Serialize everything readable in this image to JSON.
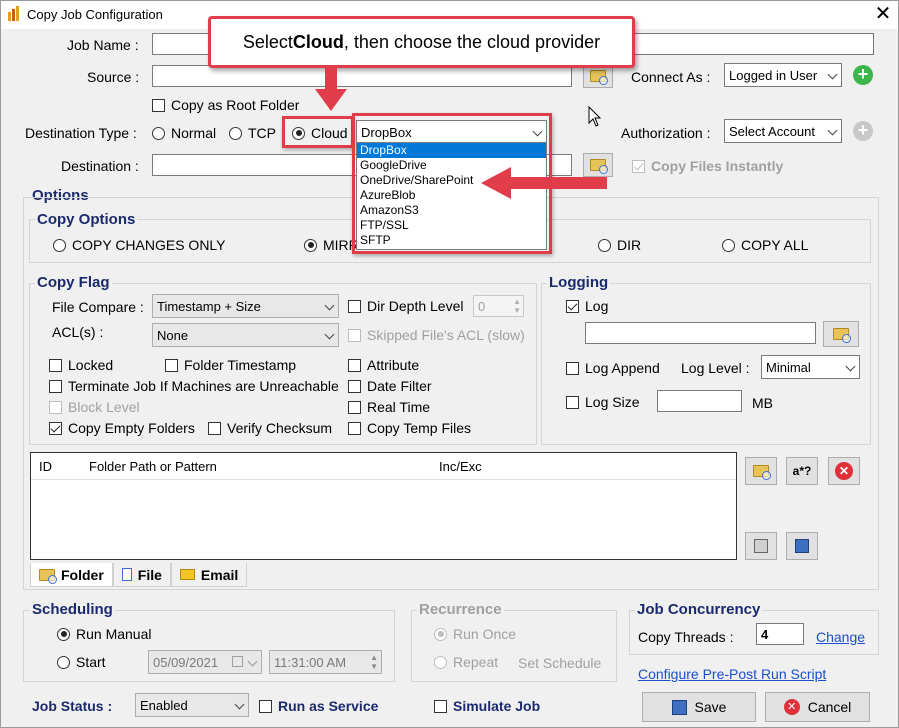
{
  "window": {
    "title": "Copy Job Configuration",
    "close": "✕"
  },
  "callout": {
    "prefix": "Select ",
    "bold": "Cloud",
    "suffix": ", then choose the cloud provider"
  },
  "form": {
    "job_name_label": "Job Name :",
    "source_label": "Source :",
    "connect_as_label": "Connect As :",
    "connect_as_value": "Logged in User",
    "copy_as_root_label": "Copy as Root Folder",
    "dest_type_label": "Destination Type :",
    "dest_types": [
      "Normal",
      "TCP",
      "Cloud"
    ],
    "dest_type_selected": "Cloud",
    "cloud_provider_value": "DropBox",
    "authorization_label": "Authorization :",
    "authorization_value": "Select Account",
    "destination_label": "Destination :",
    "copy_instantly_label": "Copy Files Instantly"
  },
  "cloud_providers": [
    "DropBox",
    "GoogleDrive",
    "OneDrive/SharePoint",
    "AzureBlob",
    "AmazonS3",
    "FTP/SSL",
    "SFTP"
  ],
  "cloud_provider_selected": "DropBox",
  "options": {
    "title": "Options",
    "copy_options_title": "Copy Options",
    "copy_options": [
      "COPY CHANGES ONLY",
      "MIRR",
      "DIR",
      "COPY ALL"
    ]
  },
  "copy_flag": {
    "title": "Copy Flag",
    "file_compare_label": "File Compare :",
    "file_compare_value": "Timestamp + Size",
    "acl_label": "ACL(s) :",
    "acl_value": "None",
    "dir_depth_label": "Dir Depth Level",
    "dir_depth_value": "0",
    "skipped_acl_label": "Skipped File's ACL (slow)",
    "locked": "Locked",
    "folder_timestamp": "Folder Timestamp",
    "attribute": "Attribute",
    "terminate": "Terminate Job If Machines are Unreachable",
    "date_filter": "Date Filter",
    "block_level": "Block Level",
    "real_time": "Real Time",
    "copy_empty": "Copy Empty Folders",
    "verify_checksum": "Verify Checksum",
    "copy_temp": "Copy Temp Files"
  },
  "logging": {
    "title": "Logging",
    "log_label": "Log",
    "log_append_label": "Log Append",
    "log_level_label": "Log Level :",
    "log_level_value": "Minimal",
    "log_size_label": "Log Size",
    "log_size_unit": "MB"
  },
  "filter_table": {
    "headers": [
      "ID",
      "Folder Path or Pattern",
      "Inc/Exc"
    ],
    "pattern_button": "a*?"
  },
  "tabs": [
    "Folder",
    "File",
    "Email"
  ],
  "scheduling": {
    "title": "Scheduling",
    "run_manual": "Run Manual",
    "start": "Start",
    "start_date": "05/09/2021",
    "start_time": "11:31:00 AM"
  },
  "recurrence": {
    "title": "Recurrence",
    "run_once": "Run Once",
    "repeat": "Repeat",
    "set_schedule": "Set Schedule"
  },
  "concurrency": {
    "title": "Job Concurrency",
    "threads_label": "Copy Threads :",
    "threads_value": "4",
    "change_link": "Change"
  },
  "pre_post_link": "Configure Pre-Post Run Script",
  "footer": {
    "job_status_label": "Job Status :",
    "job_status_value": "Enabled",
    "run_as_service": "Run as Service",
    "simulate_job": "Simulate Job",
    "save": "Save",
    "cancel": "Cancel"
  },
  "colors": {
    "accent_red": "#e03c4a",
    "selection_blue": "#0078d7",
    "group_title_navy": "#1a2a6c",
    "link_blue": "#1a4fd0"
  }
}
